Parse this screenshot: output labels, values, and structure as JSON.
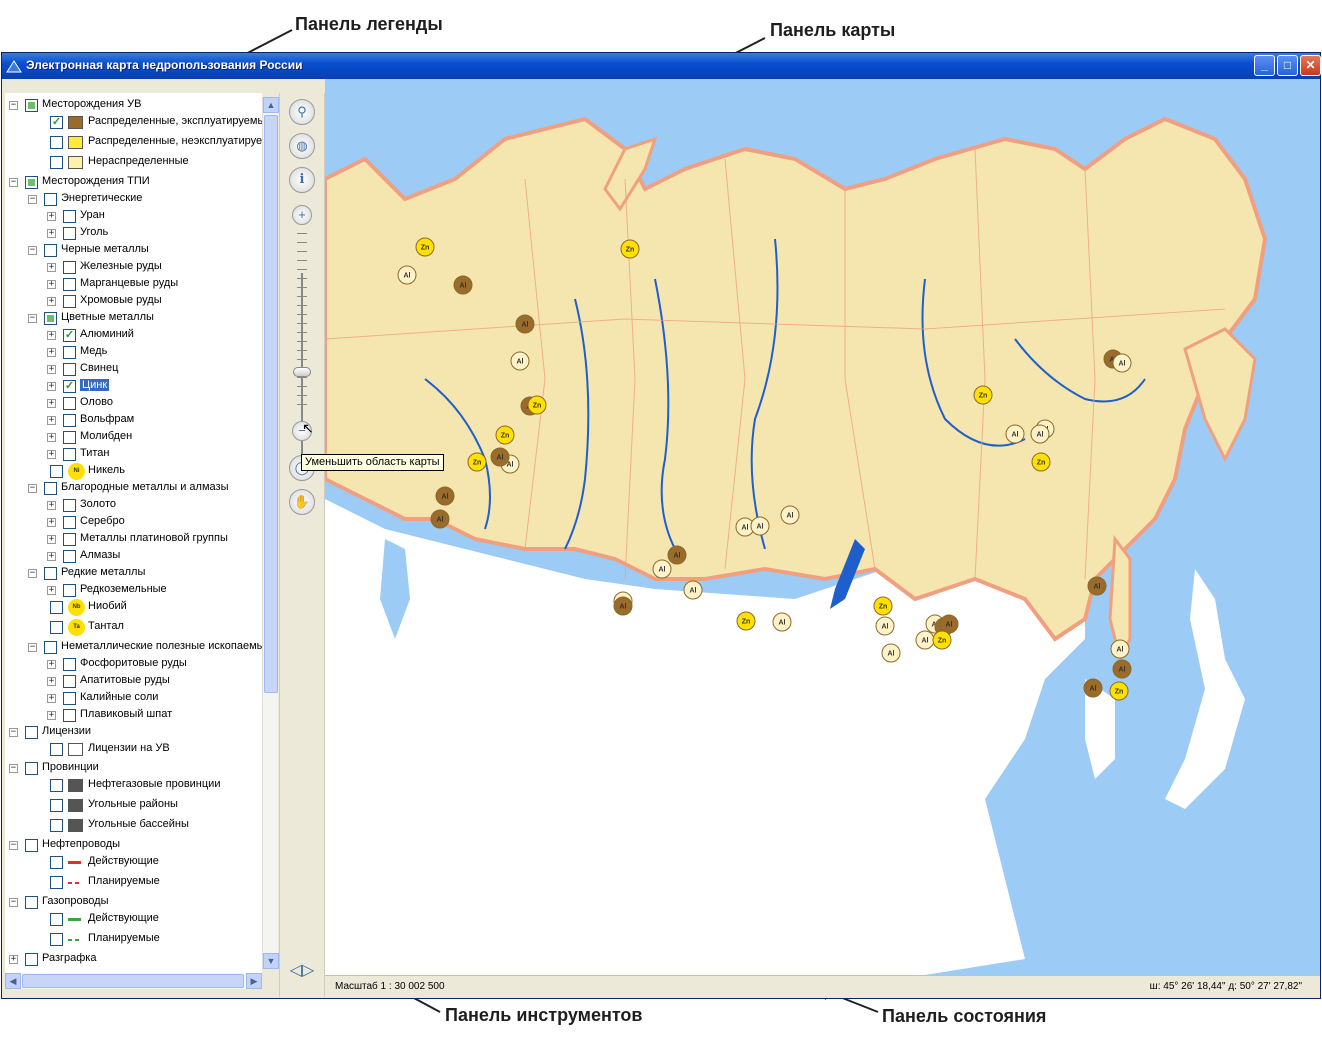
{
  "annotations": {
    "legend_panel": "Панель легенды",
    "map_panel": "Панель карты",
    "tools_panel": "Панель инструментов",
    "status_panel": "Панель состояния"
  },
  "window": {
    "title": "Электронная карта недропользования России",
    "buttons": {
      "minimize": "_",
      "maximize": "□",
      "close": "✕"
    }
  },
  "legend": {
    "items": [
      {
        "label": "Месторождения УВ",
        "level": 0,
        "expander": "−",
        "checked": "partial"
      },
      {
        "label": "Распределенные, эксплуатируемые",
        "level": 2,
        "expander": "",
        "checked": "yes",
        "symbol": "box",
        "color": "#9a6b2a"
      },
      {
        "label": "Распределенные, неэксплуатируемые",
        "level": 2,
        "expander": "",
        "checked": "no",
        "symbol": "box",
        "color": "#ffea3c"
      },
      {
        "label": "Нераспределенные",
        "level": 2,
        "expander": "",
        "checked": "no",
        "symbol": "box",
        "color": "#fff2a8"
      },
      {
        "label": "Месторождения ТПИ",
        "level": 0,
        "expander": "−",
        "checked": "partial"
      },
      {
        "label": "Энергетические",
        "level": 1,
        "expander": "−",
        "checked": "no"
      },
      {
        "label": "Уран",
        "level": 2,
        "expander": "+",
        "checked": "no"
      },
      {
        "label": "Уголь",
        "level": 2,
        "expander": "+",
        "checked": "no"
      },
      {
        "label": "Черные металлы",
        "level": 1,
        "expander": "−",
        "checked": "no"
      },
      {
        "label": "Железные руды",
        "level": 2,
        "expander": "+",
        "checked": "no"
      },
      {
        "label": "Марганцевые руды",
        "level": 2,
        "expander": "+",
        "checked": "no"
      },
      {
        "label": "Хромовые руды",
        "level": 2,
        "expander": "+",
        "checked": "no"
      },
      {
        "label": "Цветные металлы",
        "level": 1,
        "expander": "−",
        "checked": "partial"
      },
      {
        "label": "Алюминий",
        "level": 2,
        "expander": "+",
        "checked": "yes"
      },
      {
        "label": "Медь",
        "level": 2,
        "expander": "+",
        "checked": "no"
      },
      {
        "label": "Свинец",
        "level": 2,
        "expander": "+",
        "checked": "no"
      },
      {
        "label": "Цинк",
        "level": 2,
        "expander": "+",
        "checked": "yes",
        "selected": true
      },
      {
        "label": "Олово",
        "level": 2,
        "expander": "+",
        "checked": "no"
      },
      {
        "label": "Вольфрам",
        "level": 2,
        "expander": "+",
        "checked": "no"
      },
      {
        "label": "Молибден",
        "level": 2,
        "expander": "+",
        "checked": "no"
      },
      {
        "label": "Титан",
        "level": 2,
        "expander": "+",
        "checked": "no"
      },
      {
        "label": "Никель",
        "level": 2,
        "expander": "",
        "checked": "no",
        "symbol": "circle",
        "color": "#ffe000",
        "code": "Ni"
      },
      {
        "label": "Благородные металлы и алмазы",
        "level": 1,
        "expander": "−",
        "checked": "no"
      },
      {
        "label": "Золото",
        "level": 2,
        "expander": "+",
        "checked": "no"
      },
      {
        "label": "Серебро",
        "level": 2,
        "expander": "+",
        "checked": "no"
      },
      {
        "label": "Металлы платиновой группы",
        "level": 2,
        "expander": "+",
        "checked": "no"
      },
      {
        "label": "Алмазы",
        "level": 2,
        "expander": "+",
        "checked": "no"
      },
      {
        "label": "Редкие металлы",
        "level": 1,
        "expander": "−",
        "checked": "no"
      },
      {
        "label": "Редкоземельные",
        "level": 2,
        "expander": "+",
        "checked": "no"
      },
      {
        "label": "Ниобий",
        "level": 2,
        "expander": "",
        "checked": "no",
        "symbol": "circle",
        "color": "#ffe000",
        "code": "Nb"
      },
      {
        "label": "Тантал",
        "level": 2,
        "expander": "",
        "checked": "no",
        "symbol": "circle",
        "color": "#ffe000",
        "code": "Ta"
      },
      {
        "label": "Неметаллические полезные ископаемые",
        "level": 1,
        "expander": "−",
        "checked": "no"
      },
      {
        "label": "Фосфоритовые руды",
        "level": 2,
        "expander": "+",
        "checked": "no"
      },
      {
        "label": "Апатитовые руды",
        "level": 2,
        "expander": "+",
        "checked": "no"
      },
      {
        "label": "Калийные соли",
        "level": 2,
        "expander": "+",
        "checked": "no"
      },
      {
        "label": "Плавиковый шпат",
        "level": 2,
        "expander": "+",
        "checked": "no"
      },
      {
        "label": "Лицензии",
        "level": 0,
        "expander": "−",
        "checked": "no"
      },
      {
        "label": "Лицензии на УВ",
        "level": 2,
        "expander": "",
        "checked": "no",
        "symbol": "box",
        "color": "#ffffff"
      },
      {
        "label": "Провинции",
        "level": 0,
        "expander": "−",
        "checked": "no"
      },
      {
        "label": "Нефтегазовые провинции",
        "level": 2,
        "expander": "",
        "checked": "no",
        "symbol": "box",
        "color": "#555555"
      },
      {
        "label": "Угольные районы",
        "level": 2,
        "expander": "",
        "checked": "no",
        "symbol": "box",
        "color": "#555555"
      },
      {
        "label": "Угольные бассейны",
        "level": 2,
        "expander": "",
        "checked": "no",
        "symbol": "box",
        "color": "#555555"
      },
      {
        "label": "Нефтепроводы",
        "level": 0,
        "expander": "−",
        "checked": "no"
      },
      {
        "label": "Действующие",
        "level": 2,
        "expander": "",
        "checked": "no",
        "symbol": "line",
        "color": "#e03030"
      },
      {
        "label": "Планируемые",
        "level": 2,
        "expander": "",
        "checked": "no",
        "symbol": "dash",
        "color": "#e03030"
      },
      {
        "label": "Газопроводы",
        "level": 0,
        "expander": "−",
        "checked": "no"
      },
      {
        "label": "Действующие",
        "level": 2,
        "expander": "",
        "checked": "no",
        "symbol": "line",
        "color": "#3ca83c"
      },
      {
        "label": "Планируемые",
        "level": 2,
        "expander": "",
        "checked": "no",
        "symbol": "dash",
        "color": "#3ca83c"
      },
      {
        "label": "Разграфка",
        "level": 0,
        "expander": "+",
        "checked": "no"
      }
    ]
  },
  "toolbar": {
    "tools": [
      {
        "name": "binoculars-icon",
        "glyph": "⚲"
      },
      {
        "name": "globe-icon",
        "glyph": "◍"
      },
      {
        "name": "info-icon",
        "glyph": "i"
      },
      {
        "name": "zoom-in-icon",
        "glyph": "+"
      },
      {
        "name": "zoom-out-icon",
        "glyph": "−"
      },
      {
        "name": "refresh-icon",
        "glyph": "◯"
      },
      {
        "name": "pan-hand-icon",
        "glyph": "✋"
      }
    ],
    "tooltip": "Уменьшить область карты",
    "collapse_icon": "◁▷"
  },
  "map": {
    "colors": {
      "sea": "#9ccbf6",
      "land_russia": "#f5e6b0",
      "border": "#f0a080",
      "foreign_land": "#ffffff",
      "river": "#1e5fcc"
    },
    "markers": [
      {
        "code": "Zn",
        "color": "#ffe000"
      },
      {
        "code": "Al",
        "color": "#9a6b2a"
      },
      {
        "code": "Al",
        "color": "#fff2c8"
      },
      {
        "code": "Zn",
        "color": "#fff2c8"
      }
    ]
  },
  "status": {
    "scale": "Масштаб 1 : 30 002 500",
    "coords": "ш: 45° 26' 18,44\" д: 50° 27' 27,82\""
  }
}
